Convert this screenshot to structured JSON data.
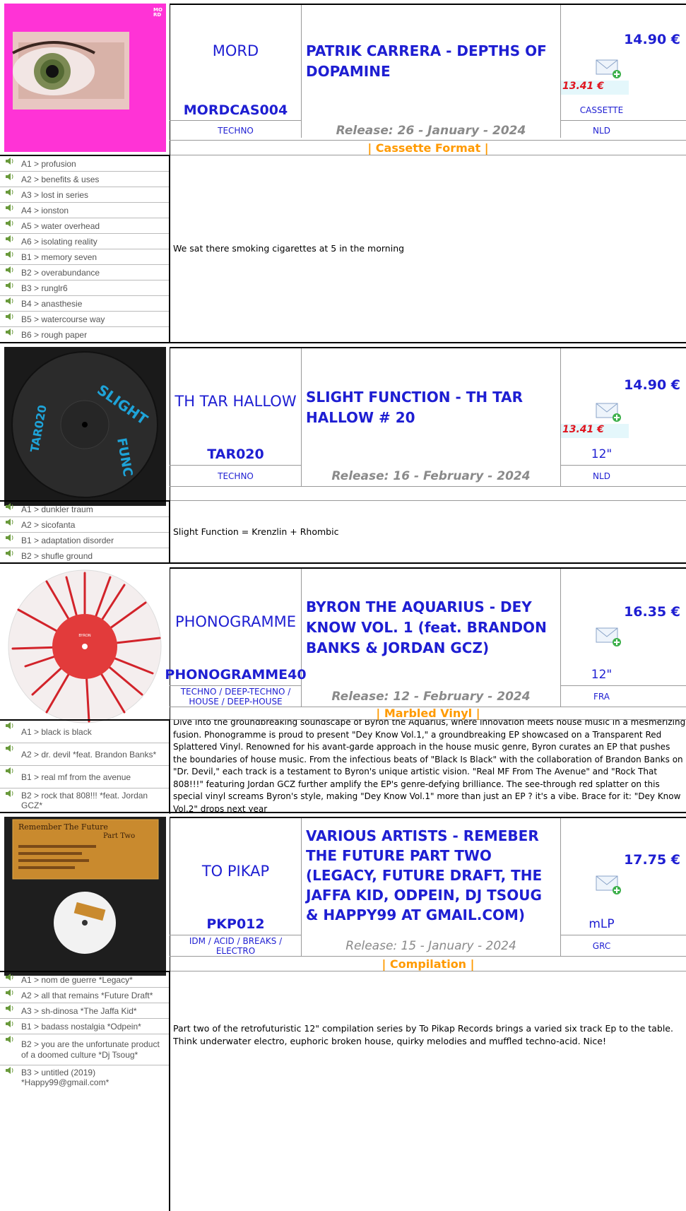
{
  "releases": [
    {
      "label": "MORD",
      "title": "PATRIK CARRERA - DEPTHS OF DOPAMINE",
      "catalog": "MORDCAS004",
      "genre": "TECHNO",
      "release": "Release: 26 - January - 2024",
      "price": "14.90 €",
      "discount_price": "13.41 €",
      "format": "CASSETTE",
      "country": "NLD",
      "note": "| Cassette Format |",
      "description": "We sat there smoking cigarettes at 5 in the morning",
      "cover_logo": "MO RD",
      "tracks": [
        "A1 > profusion",
        "A2 > benefits & uses",
        "A3 > lost in series",
        "A4 > ionston",
        "A5 > water overhead",
        "A6 > isolating reality",
        "B1 > memory seven",
        "B2 > overabundance",
        "B3 > runglr6",
        "B4 > anasthesie",
        "B5 > watercourse way",
        "B6 > rough paper"
      ]
    },
    {
      "label": "TH TAR HALLOW",
      "title": "SLIGHT FUNCTION - TH TAR HALLOW # 20",
      "catalog": "TAR020",
      "genre": "TECHNO",
      "release": "Release: 16 - February - 2024",
      "price": "14.90 €",
      "discount_price": "13.41 €",
      "format": "12\"",
      "country": "NLD",
      "note": "",
      "description": "Slight Function = Krenzlin + Rhombic",
      "cover_text_a": "SLIGHT FUNCTION",
      "cover_text_b": "TAR020",
      "tracks": [
        "A1 > dunkler traum",
        "A2 > sicofanta",
        "B1 > adaptation disorder",
        "B2 > shufle ground"
      ]
    },
    {
      "label": "PHONOGRAMME",
      "title": "BYRON THE AQUARIUS - DEY KNOW VOL. 1 (feat. BRANDON BANKS & JORDAN GCZ)",
      "catalog": "PHONOGRAMME40",
      "genre": "TECHNO / DEEP-TECHNO / HOUSE / DEEP-HOUSE",
      "release": "Release: 12 - February - 2024",
      "price": "16.35 €",
      "format": "12\"",
      "country": "FRA",
      "note": "| Marbled Vinyl |",
      "description": "Dive into the groundbreaking soundscape of Byron the Aquarius, where innovation meets house music in a mesmerizing fusion. Phonogramme is proud to present \"Dey Know Vol.1,\" a groundbreaking EP showcased on a Transparent Red Splattered Vinyl. Renowned for his avant-garde approach in the house music genre, Byron curates an EP that pushes the boundaries of house music. From the infectious beats of \"Black Is Black\" with the collaboration of Brandon Banks on \"Dr. Devil,\" each track is a testament to Byron's unique artistic vision. \"Real MF From The Avenue\" and \"Rock That 808!!!\" featuring Jordan GCZ further amplify the EP's genre-defying brilliance. The see-through red splatter on this special vinyl screams Byron's style, making \"Dey Know Vol.1\" more than just an EP ? it's a vibe. Brace for it: \"Dey Know Vol.2\" drops next year",
      "tracks": [
        "A1 > black is black",
        "A2 > dr. devil *feat. Brandon Banks*",
        "B1 > real mf from the avenue",
        "B2 > rock that 808!!! *feat. Jordan GCZ*"
      ]
    },
    {
      "label": "TO PIKAP",
      "title": "VARIOUS ARTISTS - REMEBER THE FUTURE PART TWO (LEGACY, FUTURE DRAFT, THE JAFFA KID, ODPEIN, DJ TSOUG & HAPPY99 AT GMAIL.COM)",
      "catalog": "PKP012",
      "genre": "IDM / ACID / BREAKS / ELECTRO",
      "release": "Release: 15 - January - 2024",
      "price": "17.75 €",
      "format": "mLP",
      "country": "GRC",
      "note": "| Compilation |",
      "description": "Part two of the retrofuturistic 12\" compilation series by To Pikap Records brings a varied six track Ep to the table. Think underwater electro, euphoric broken house, quirky melodies and muffled techno-acid. Nice!",
      "cover_title": "Remember The Future",
      "cover_sub": "Part Two",
      "tracks": [
        "A1 > nom de guerre *Legacy*",
        "A2 > all that remains *Future Draft*",
        "A3 > sh-dinosa *The Jaffa Kid*",
        "B1 > badass nostalgia *Odpein*",
        "B2 > you are the unfortunate product of a doomed culture *Dj Tsoug*",
        "B3 > untitled (2019) *Happy99@gmail.com*"
      ]
    }
  ]
}
